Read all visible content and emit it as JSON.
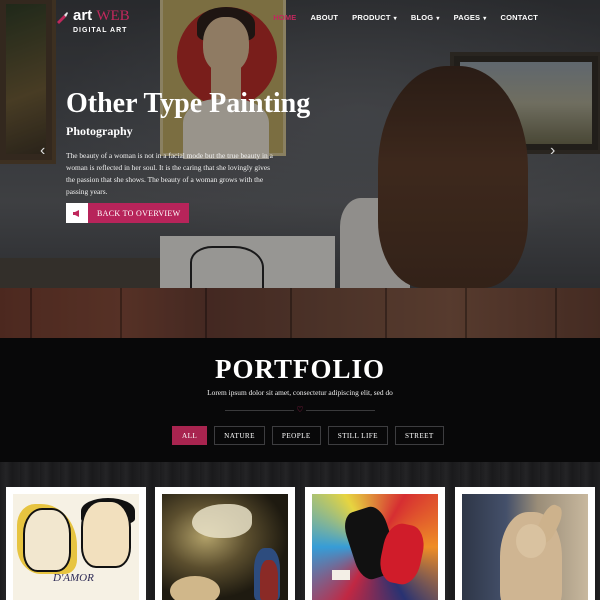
{
  "brand": {
    "name_part1": "art",
    "name_part2": "WEB",
    "tagline": "DIGITAL ART",
    "accent_color": "#c0285c"
  },
  "nav": {
    "items": [
      {
        "label": "HOME",
        "active": true,
        "dropdown": false
      },
      {
        "label": "ABOUT",
        "active": false,
        "dropdown": false
      },
      {
        "label": "PRODUCT",
        "active": false,
        "dropdown": true
      },
      {
        "label": "BLOG",
        "active": false,
        "dropdown": true
      },
      {
        "label": "PAGES",
        "active": false,
        "dropdown": true
      },
      {
        "label": "CONTACT",
        "active": false,
        "dropdown": false
      }
    ],
    "caret": "▾"
  },
  "hero": {
    "title": "Other Type Painting",
    "subtitle": "Photography",
    "text": "The beauty of a woman is not in a facial mode but the true beauty in a woman is reflected in her soul. It is the caring that she lovingly gives the passion that she shows. The beauty of a woman grows with the passing years.",
    "cta_label": "BACK TO OVERVIEW",
    "cta_icon": "megaphone-icon",
    "prev_arrow": "‹",
    "next_arrow": "›"
  },
  "portfolio": {
    "title": "PORTFOLIO",
    "subtitle": "Lorem ipsum dolor sit amet, consectetur adipiscing elit, sed do",
    "divider_icon": "♡",
    "filters": [
      {
        "label": "ALL",
        "active": true
      },
      {
        "label": "NATURE",
        "active": false
      },
      {
        "label": "PEOPLE",
        "active": false
      },
      {
        "label": "STILL LIFE",
        "active": false
      },
      {
        "label": "STREET",
        "active": false
      }
    ],
    "items": [
      {
        "art": "two-faces-drawing",
        "caption": "D'AMOR"
      },
      {
        "art": "angel-painting",
        "caption": ""
      },
      {
        "art": "abstract-color-painting",
        "caption": ""
      },
      {
        "art": "statue-photo",
        "caption": ""
      }
    ]
  }
}
